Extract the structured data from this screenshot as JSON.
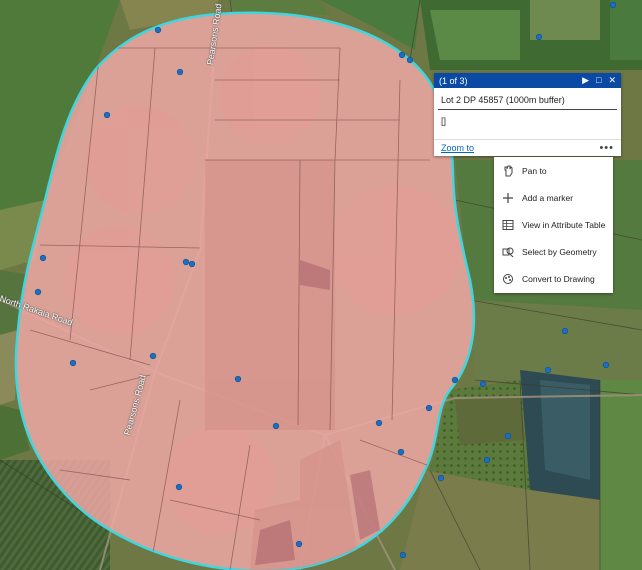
{
  "popup": {
    "counter": "(1 of 3)",
    "title": "Lot 2 DP 45857 (1000m buffer)",
    "content": "[]",
    "zoom_link": "Zoom to",
    "more_icon": "ellipsis-icon",
    "header_buttons": [
      "next-icon",
      "dock-icon",
      "close-icon"
    ]
  },
  "menu": {
    "items": [
      {
        "label": "Pan to",
        "icon": "pan-icon"
      },
      {
        "label": "Add a marker",
        "icon": "plus-icon"
      },
      {
        "label": "View in Attribute Table",
        "icon": "table-icon"
      },
      {
        "label": "Select by Geometry",
        "icon": "select-geometry-icon"
      },
      {
        "label": "Convert to Drawing",
        "icon": "drawing-icon"
      }
    ]
  },
  "map": {
    "road_labels": [
      "North Rakaia Road",
      "Pearsons Road",
      "Pearsons Road"
    ],
    "colors": {
      "buffer_fill": "#f4aaa8",
      "buffer_outline": "#3fd6e0",
      "points": "#1a6fc2",
      "farmland": "#5f6b3e",
      "ui_accent": "#0a4aa5"
    }
  }
}
